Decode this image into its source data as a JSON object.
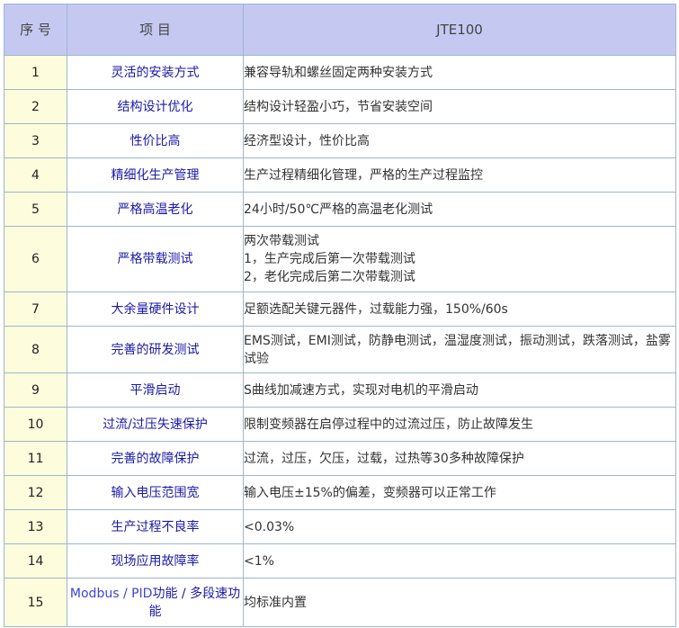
{
  "header": {
    "no": "序 号",
    "item": "项  目",
    "model": "JTE100"
  },
  "rows": [
    {
      "no": "1",
      "item": "灵活的安装方式",
      "desc": [
        "兼容导轨和螺丝固定两种安装方式"
      ]
    },
    {
      "no": "2",
      "item": "结构设计优化",
      "desc": [
        "结构设计轻盈小巧，节省安装空间"
      ]
    },
    {
      "no": "3",
      "item": "性价比高",
      "desc": [
        "经济型设计，性价比高"
      ]
    },
    {
      "no": "4",
      "item": "精细化生产管理",
      "desc": [
        "生产过程精细化管理，严格的生产过程监控"
      ]
    },
    {
      "no": "5",
      "item": "严格高温老化",
      "desc": [
        "24小时/50℃严格的高温老化测试"
      ]
    },
    {
      "no": "6",
      "item": "严格带载测试",
      "desc": [
        "两次带载测试",
        "1，生产完成后第一次带载测试",
        "2，老化完成后第二次带载测试"
      ]
    },
    {
      "no": "7",
      "item": "大余量硬件设计",
      "desc": [
        "足额选配关键元器件，过载能力强，150%/60s"
      ]
    },
    {
      "no": "8",
      "item": "完善的研发测试",
      "desc": [
        "EMS测试，EMI测试，防静电测试，温湿度测试，振动测试，跌落测试，盐雾试验"
      ]
    },
    {
      "no": "9",
      "item": "平滑启动",
      "desc": [
        "S曲线加减速方式，实现对电机的平滑启动"
      ]
    },
    {
      "no": "10",
      "item": "过流/过压失速保护",
      "desc": [
        "限制变频器在启停过程中的过流过压，防止故障发生"
      ]
    },
    {
      "no": "11",
      "item": "完善的故障保护",
      "desc": [
        "过流，过压，欠压，过载，过热等30多种故障保护"
      ]
    },
    {
      "no": "12",
      "item": "输入电压范围宽",
      "desc": [
        "输入电压±15%的偏差，变频器可以正常工作"
      ]
    },
    {
      "no": "13",
      "item": "生产过程不良率",
      "desc": [
        "<0.03%"
      ]
    },
    {
      "no": "14",
      "item": "现场应用故障率",
      "desc": [
        "<1%"
      ]
    },
    {
      "no": "15",
      "item_accent": "Modbus / PID",
      "item_rest": "功能 / 多段速功能",
      "desc": [
        "均标准内置"
      ]
    }
  ]
}
